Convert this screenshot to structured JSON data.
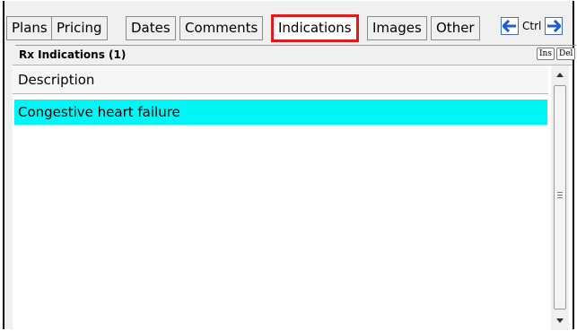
{
  "tabs": [
    {
      "label": "Plans",
      "active": false
    },
    {
      "label": "Pricing",
      "active": false
    },
    {
      "label": "Dates",
      "active": false
    },
    {
      "label": "Comments",
      "active": false
    },
    {
      "label": "Indications",
      "active": true
    },
    {
      "label": "Images",
      "active": false
    },
    {
      "label": "Other",
      "active": false
    }
  ],
  "nav": {
    "ctrl_label": "Ctrl",
    "prev_icon": "arrow-left-icon",
    "next_icon": "arrow-right-icon"
  },
  "panel": {
    "title": "Rx Indications (1)",
    "ins_label": "Ins",
    "del_label": "Del"
  },
  "grid": {
    "column_header": "Description",
    "rows": [
      {
        "description": "Congestive heart failure",
        "selected": true
      }
    ]
  },
  "colors": {
    "selection": "#00f5f5",
    "active_tab_border": "#e01b1b",
    "nav_arrow": "#1e5cd6"
  }
}
